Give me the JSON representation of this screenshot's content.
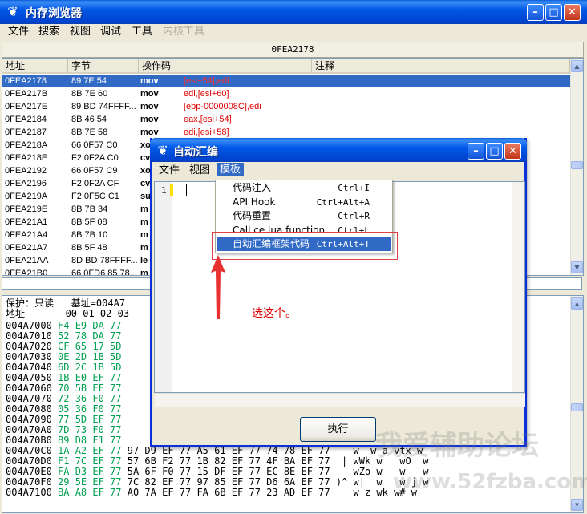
{
  "main": {
    "title": "内存浏览器",
    "menu": [
      "文件",
      "搜索",
      "视图",
      "调试",
      "工具",
      "内核工具"
    ],
    "address": "0FEA2178",
    "columns": [
      "地址",
      "字节",
      "操作码",
      "注释"
    ],
    "rows": [
      {
        "addr": "0FEA2178",
        "bytes": "89 7E 54",
        "op": "mov",
        "arg": "[esi+54],edi"
      },
      {
        "addr": "0FEA217B",
        "bytes": "8B 7E 60",
        "op": "mov",
        "arg": "edi,[esi+60]"
      },
      {
        "addr": "0FEA217E",
        "bytes": "89 BD 74FFFF...",
        "op": "mov",
        "arg": "[ebp-0000008C],edi"
      },
      {
        "addr": "0FEA2184",
        "bytes": "8B 46 54",
        "op": "mov",
        "arg": "eax,[esi+54]"
      },
      {
        "addr": "0FEA2187",
        "bytes": "8B 7E 58",
        "op": "mov",
        "arg": "edi,[esi+58]"
      },
      {
        "addr": "0FEA218A",
        "bytes": "66 0F57 C0",
        "op": "xo",
        "arg": ""
      },
      {
        "addr": "0FEA218E",
        "bytes": "F2 0F2A C0",
        "op": "cv",
        "arg": ""
      },
      {
        "addr": "0FEA2192",
        "bytes": "66 0F57 C9",
        "op": "xo",
        "arg": ""
      },
      {
        "addr": "0FEA2196",
        "bytes": "F2 0F2A CF",
        "op": "cv",
        "arg": ""
      },
      {
        "addr": "0FEA219A",
        "bytes": "F2 0F5C C1",
        "op": "su",
        "arg": ""
      },
      {
        "addr": "0FEA219E",
        "bytes": "8B 7B 34",
        "op": "m",
        "arg": ""
      },
      {
        "addr": "0FEA21A1",
        "bytes": "8B 5F 08",
        "op": "m",
        "arg": ""
      },
      {
        "addr": "0FEA21A4",
        "bytes": "8B 7B 10",
        "op": "m",
        "arg": ""
      },
      {
        "addr": "0FEA21A7",
        "bytes": "8B 5F 48",
        "op": "m",
        "arg": ""
      },
      {
        "addr": "0FEA21AA",
        "bytes": "8D BD 78FFFF...",
        "op": "le",
        "arg": ""
      },
      {
        "addr": "0FEA21B0",
        "bytes": "66 0FD6 85 78...",
        "op": "m",
        "arg": ""
      }
    ],
    "hex_info_line1": "保护：只读   基址=004A7",
    "hex_info_line2": "地址       00 01 02 03",
    "hex_rows": [
      {
        "addr": "004A7000",
        "hex": "F4 E9 DA 77",
        "rest": ""
      },
      {
        "addr": "004A7010",
        "hex": "52 78 DA 77",
        "rest": ""
      },
      {
        "addr": "004A7020",
        "hex": "CF 65 17 5D",
        "rest": ""
      },
      {
        "addr": "004A7030",
        "hex": "0E 2D 1B 5D",
        "rest": ""
      },
      {
        "addr": "004A7040",
        "hex": "6D 2C 1B 5D",
        "rest": ""
      },
      {
        "addr": "004A7050",
        "hex": "1B E0 EF 77",
        "rest": ""
      },
      {
        "addr": "004A7060",
        "hex": "70 5B EF 77",
        "rest": ""
      },
      {
        "addr": "004A7070",
        "hex": "72 36 F0 77",
        "rest": ""
      },
      {
        "addr": "004A7080",
        "hex": "05 36 F0 77",
        "rest": ""
      },
      {
        "addr": "004A7090",
        "hex": "77 5D EF 77",
        "rest": ""
      },
      {
        "addr": "004A70A0",
        "hex": "7D 73 F0 77",
        "rest": ""
      },
      {
        "addr": "004A70B0",
        "hex": "89 D8 F1 77",
        "rest": ""
      },
      {
        "addr": "004A70C0",
        "hex": "1A A2 EF 77",
        "rest": "97 D9 EF 77 A5 61 EF 77 74 78 EF 77    w  w a vtx w"
      },
      {
        "addr": "004A70D0",
        "hex": "F1 7C EF 77",
        "rest": "57 6B F2 77 1B 82 EF 77 4F BA EF 77  | wWk w   wO  w"
      },
      {
        "addr": "004A70E0",
        "hex": "FA D3 EF 77",
        "rest": "5A 6F F0 77 15 DF EF 77 EC 8E EF 77    wZo w   w   w"
      },
      {
        "addr": "004A70F0",
        "hex": "29 5E EF 77",
        "rest": "7C 82 EF 77 97 85 EF 77 D6 6A EF 77 )^ w|  w   w j w"
      },
      {
        "addr": "004A7100",
        "hex": "BA A8 EF 77",
        "rest": "A0 7A EF 77 FA 6B EF 77 23 AD EF 77    w z wk w# w"
      }
    ]
  },
  "dialog": {
    "title": "自动汇编",
    "menu": [
      "文件",
      "视图",
      "模板"
    ],
    "line_number": "1",
    "template_items": [
      {
        "label": "代码注入",
        "shortcut": "Ctrl+I"
      },
      {
        "label": "API Hook",
        "shortcut": "Ctrl+Alt+A"
      },
      {
        "label": "代码重置",
        "shortcut": "Ctrl+R"
      },
      {
        "label": "Call ce lua function",
        "shortcut": "Ctrl+L"
      },
      {
        "label": "自动汇编框架代码",
        "shortcut": "Ctrl+Alt+T"
      }
    ],
    "execute_label": "执行"
  },
  "annotation": {
    "text": "选这个。",
    "color": "#e00000"
  },
  "watermark": {
    "line1": "我爱辅助论坛",
    "line2": "www.52fzba.com"
  },
  "colors": {
    "title_blue": "#0058e6",
    "selection": "#316ac5",
    "register_red": "#e00000",
    "hex_green": "#00a050"
  }
}
